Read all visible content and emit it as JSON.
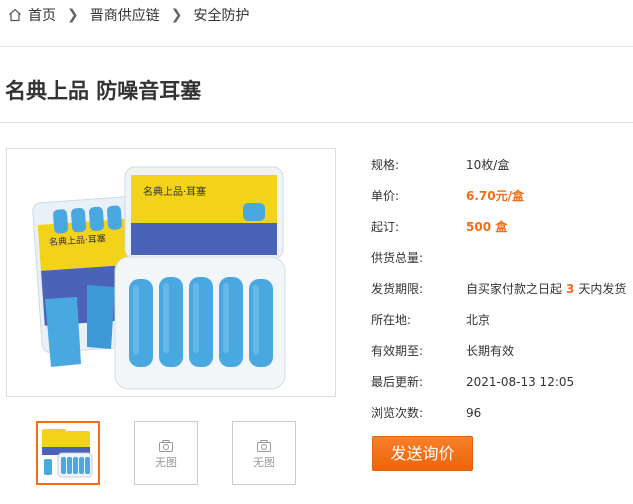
{
  "breadcrumb": {
    "home": "首页",
    "level2": "晋商供应链",
    "level3": "安全防护"
  },
  "product": {
    "title": "名典上品 防噪音耳塞",
    "image_box_text": "名典上品·耳塞",
    "image_box_count": "5"
  },
  "thumbnails": {
    "placeholder": "无图"
  },
  "specs": [
    {
      "label": "规格:",
      "value": "10枚/盒"
    },
    {
      "label": "单价:",
      "value": "6.70元/盒"
    },
    {
      "label": "起订:",
      "value": "500 盒"
    },
    {
      "label": "供货总量:",
      "value": ""
    },
    {
      "label": "发货期限:",
      "value_before": "自买家付款之日起",
      "value_highlight": "3",
      "value_after": "天内发货"
    },
    {
      "label": "所在地:",
      "value": "北京"
    },
    {
      "label": "有效期至:",
      "value": "长期有效"
    },
    {
      "label": "最后更新:",
      "value": "2021-08-13 12:05"
    },
    {
      "label": "浏览次数:",
      "value": "96"
    }
  ],
  "actions": {
    "inquiry": "发送询价"
  },
  "colors": {
    "accent": "#f26c1a",
    "product_blue": "#4aa8e0",
    "box_yellow": "#f3d21a"
  }
}
